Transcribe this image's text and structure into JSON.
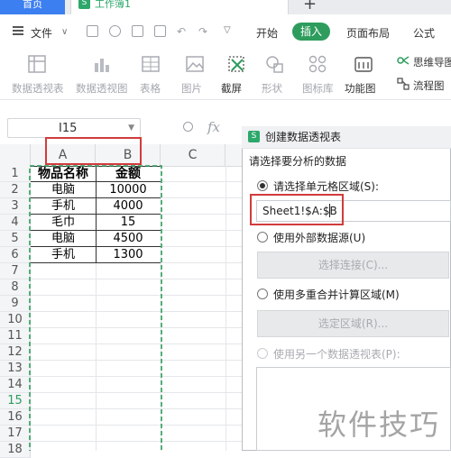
{
  "tabs": {
    "home": "首页",
    "workbook": "工作簿1",
    "new_tab": "+"
  },
  "menu": {
    "file": "文件",
    "items": [
      "开始",
      "插入",
      "页面布局",
      "公式"
    ]
  },
  "ribbon": {
    "items": [
      "数据透视表",
      "数据透视图",
      "表格",
      "图片",
      "截屏",
      "形状",
      "图标库",
      "功能图",
      "思维导图",
      "流程图"
    ]
  },
  "formula_bar": {
    "cell_ref": "I15",
    "fx": "fx"
  },
  "sheet": {
    "columns": [
      "A",
      "B",
      "C"
    ],
    "rows": [
      "1",
      "2",
      "3",
      "4",
      "5",
      "6",
      "7",
      "8",
      "9",
      "10",
      "11",
      "12",
      "13",
      "14",
      "15",
      "16",
      "17",
      "18"
    ],
    "active_row": "15",
    "header": {
      "name": "物品名称",
      "amount": "金额"
    },
    "data": [
      {
        "name": "电脑",
        "amount": "10000"
      },
      {
        "name": "手机",
        "amount": "4000"
      },
      {
        "name": "毛巾",
        "amount": "15"
      },
      {
        "name": "电脑",
        "amount": "4500"
      },
      {
        "name": "手机",
        "amount": "1300"
      }
    ]
  },
  "dialog": {
    "title": "创建数据透视表",
    "prompt": "请选择要分析的数据",
    "option_range": "请选择单元格区域(S):",
    "range_value": "Sheet1!$A:$B",
    "option_external": "使用外部数据源(U)",
    "btn_connection": "选择连接(C)...",
    "option_multi": "使用多重合并计算区域(M)",
    "btn_region": "选定区域(R)...",
    "option_another": "使用另一个数据透视表(P):"
  },
  "watermark": "软件技巧",
  "colors": {
    "accent_green": "#2e9c5d",
    "highlight_red": "#d23b3b",
    "home_tab_blue": "#3c7ff0"
  }
}
